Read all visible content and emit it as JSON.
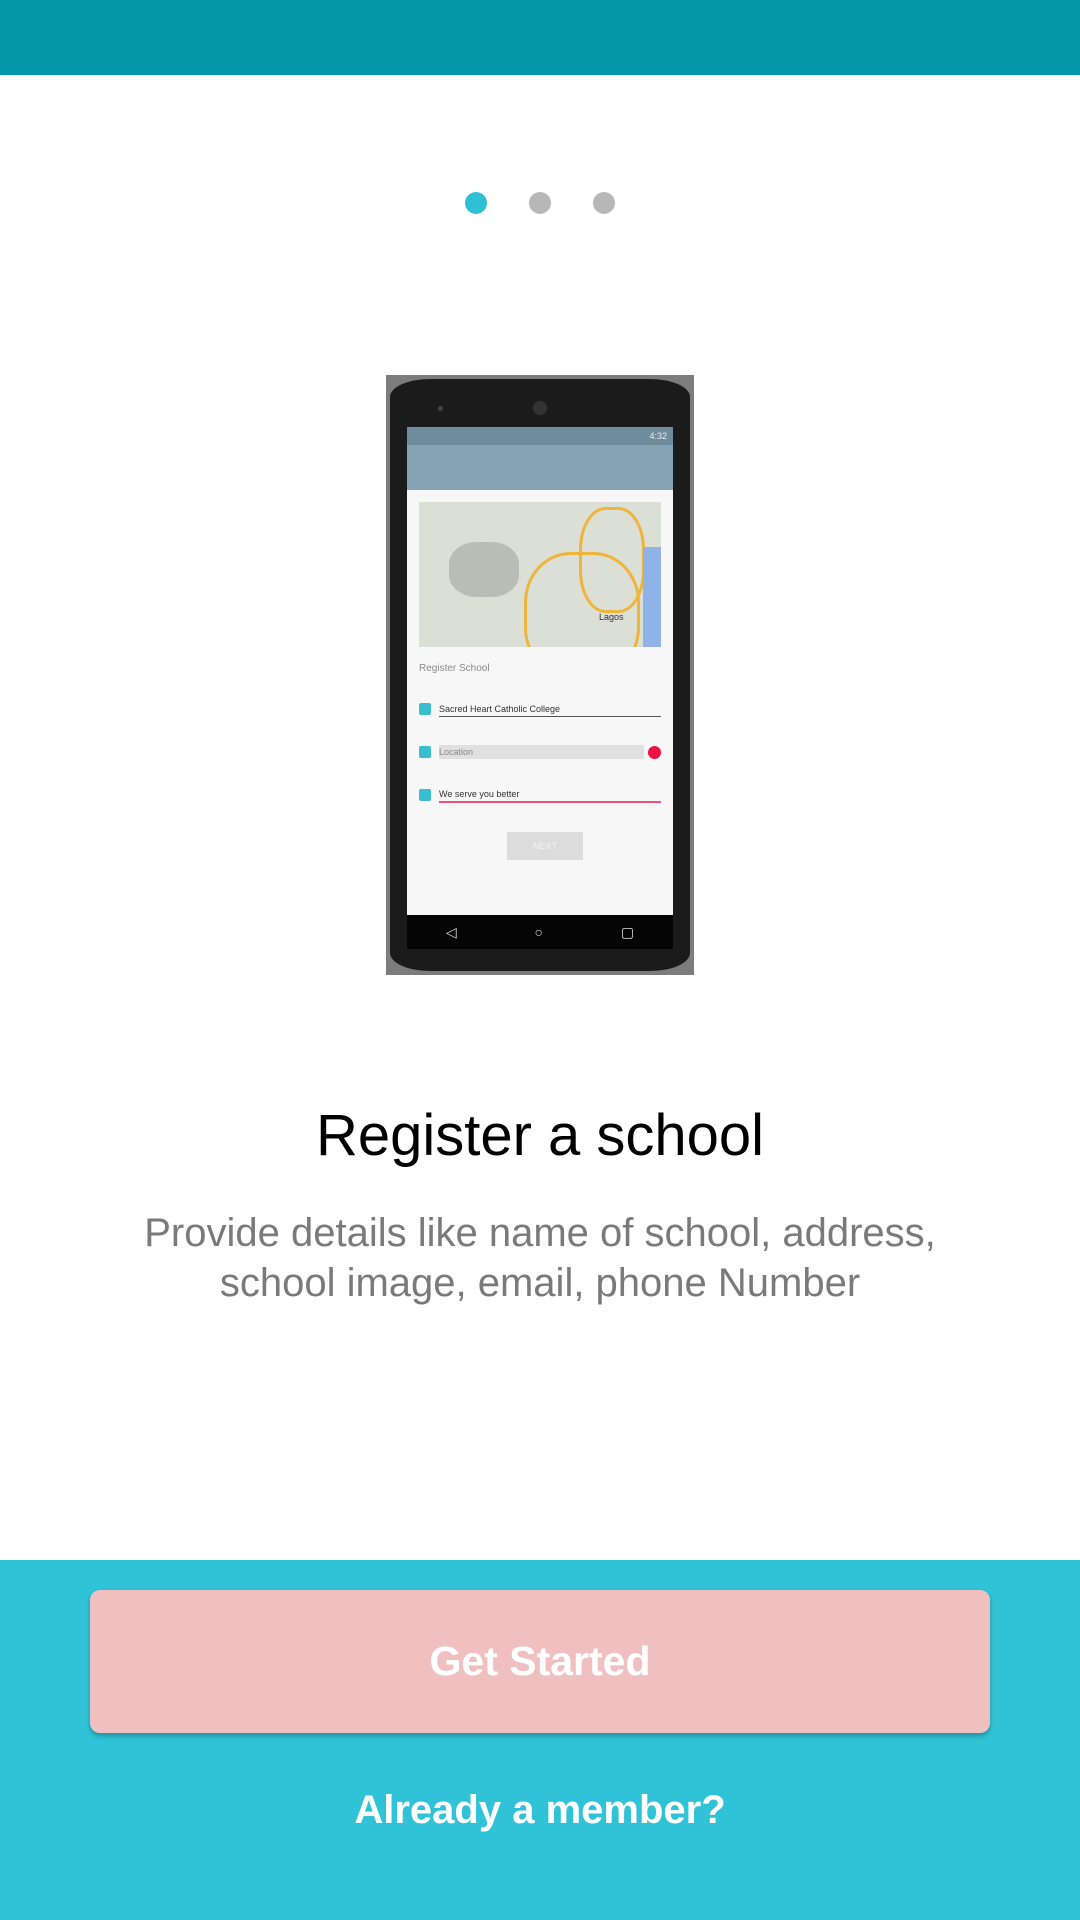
{
  "pager": {
    "total": 3,
    "active_index": 0,
    "active_color": "#2ec0d4",
    "inactive_color": "#b8b8b8"
  },
  "illustration": {
    "status_time": "4:32",
    "map_label": "Lagos",
    "form_heading": "Register School",
    "field_school_name": "Sacred Heart Catholic College",
    "field_location": "Location",
    "field_motto": "We serve you better",
    "next_label": "NEXT"
  },
  "content": {
    "title": "Register a school",
    "description": "Provide details like name of school, address, school image, email, phone Number"
  },
  "actions": {
    "get_started": "Get Started",
    "already_member": "Already a member?"
  },
  "colors": {
    "status_bar": "#0297a8",
    "bottom_panel": "#30c2d6",
    "get_started_button": "#f0c0c0"
  }
}
